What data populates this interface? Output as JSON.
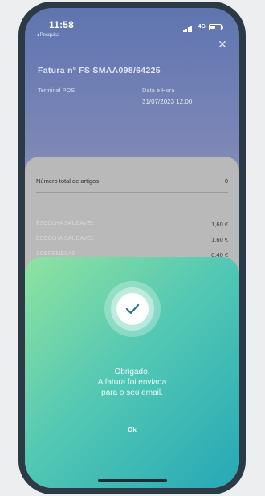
{
  "status_bar": {
    "time": "11:58",
    "back_app": "◂ Pesquisa",
    "network": "4G"
  },
  "invoice": {
    "title": "Fatura nº FS SMAA098/64225",
    "terminal_label": "Terminal POS",
    "datetime_label": "Data e Hora",
    "datetime_value": "31/07/2023 12:00"
  },
  "summary": {
    "total_label": "Número total de artigos",
    "total_value": "0",
    "items": [
      {
        "name": "ESCOLHA SAUDAVEL",
        "price": "1,60 €"
      },
      {
        "name": "ESCOLHA SAUDAVEL",
        "price": "1,60 €"
      },
      {
        "name": "SOBREMESAS",
        "price": "0,40 €"
      }
    ]
  },
  "modal": {
    "line1": "Obrigado.",
    "line2": "A fatura foi enviada",
    "line3": "para o seu email.",
    "ok_label": "Ok"
  },
  "colors": {
    "header_blue": "#5f74b0",
    "sheet_start": "#8fe3a0",
    "sheet_end": "#26a8b6"
  }
}
